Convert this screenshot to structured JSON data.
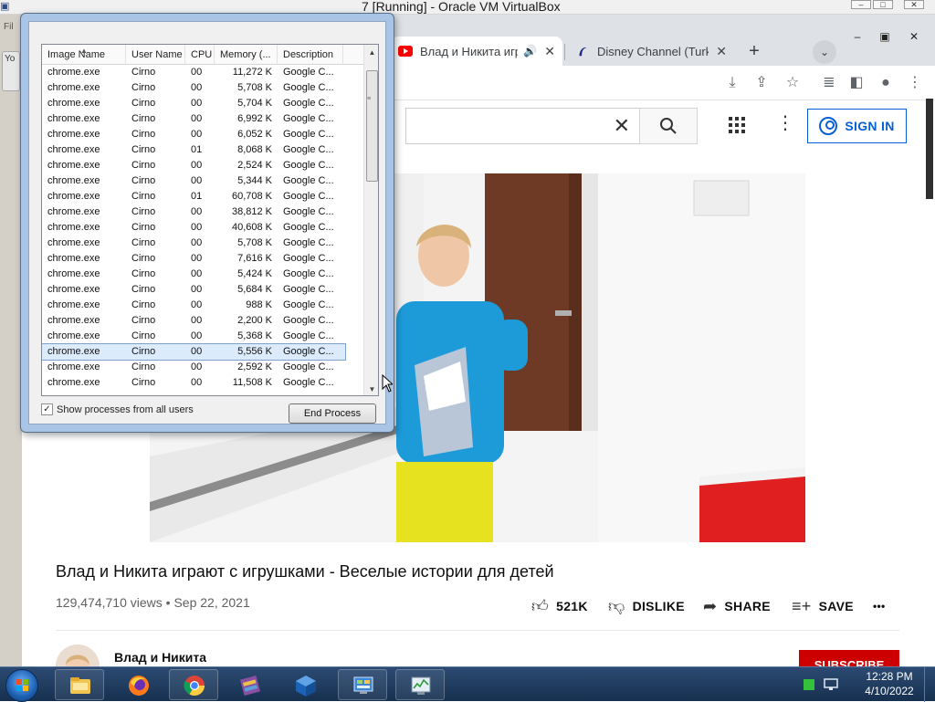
{
  "host": {
    "title": "7 [Running] - Oracle VM VirtualBox",
    "left_stub_text": "Fil",
    "left_tab_text": "Yo"
  },
  "browser": {
    "tabs": [
      {
        "label": "Влад и Никита играют",
        "favicon": "youtube-icon",
        "audio": true,
        "active": true
      },
      {
        "label": "Disney Channel (Turkey)",
        "favicon": "disney-icon",
        "audio": false,
        "active": false
      }
    ],
    "new_tab_symbol": "+",
    "tab_search_symbol": "⌄",
    "close_symbol": "✕"
  },
  "youtube": {
    "search_clear_symbol": "✕",
    "search_icon": "search-icon",
    "sign_in_label": "SIGN IN",
    "video": {
      "title": "Влад и Никита играют с игрушками - Веселые истории для детей",
      "views": "129,474,710 views",
      "separator": "•",
      "date": "Sep 22, 2021",
      "likes": "521K",
      "dislike_label": "DISLIKE",
      "share_label": "SHARE",
      "save_label": "SAVE",
      "more_symbol": "•••"
    },
    "channel": {
      "name": "Влад и Никита",
      "subscribe_label": "SUBSCRIBE"
    }
  },
  "task_manager": {
    "columns": [
      "Image Name",
      "User Name",
      "CPU",
      "Memory (...",
      "Description"
    ],
    "rows": [
      {
        "image": "chrome.exe",
        "user": "Cirno",
        "cpu": "00",
        "memory": "11,272 K",
        "desc": "Google C..."
      },
      {
        "image": "chrome.exe",
        "user": "Cirno",
        "cpu": "00",
        "memory": "5,708 K",
        "desc": "Google C..."
      },
      {
        "image": "chrome.exe",
        "user": "Cirno",
        "cpu": "00",
        "memory": "5,704 K",
        "desc": "Google C..."
      },
      {
        "image": "chrome.exe",
        "user": "Cirno",
        "cpu": "00",
        "memory": "6,992 K",
        "desc": "Google C..."
      },
      {
        "image": "chrome.exe",
        "user": "Cirno",
        "cpu": "00",
        "memory": "6,052 K",
        "desc": "Google C..."
      },
      {
        "image": "chrome.exe",
        "user": "Cirno",
        "cpu": "01",
        "memory": "8,068 K",
        "desc": "Google C..."
      },
      {
        "image": "chrome.exe",
        "user": "Cirno",
        "cpu": "00",
        "memory": "2,524 K",
        "desc": "Google C..."
      },
      {
        "image": "chrome.exe",
        "user": "Cirno",
        "cpu": "00",
        "memory": "5,344 K",
        "desc": "Google C..."
      },
      {
        "image": "chrome.exe",
        "user": "Cirno",
        "cpu": "01",
        "memory": "60,708 K",
        "desc": "Google C..."
      },
      {
        "image": "chrome.exe",
        "user": "Cirno",
        "cpu": "00",
        "memory": "38,812 K",
        "desc": "Google C..."
      },
      {
        "image": "chrome.exe",
        "user": "Cirno",
        "cpu": "00",
        "memory": "40,608 K",
        "desc": "Google C..."
      },
      {
        "image": "chrome.exe",
        "user": "Cirno",
        "cpu": "00",
        "memory": "5,708 K",
        "desc": "Google C..."
      },
      {
        "image": "chrome.exe",
        "user": "Cirno",
        "cpu": "00",
        "memory": "7,616 K",
        "desc": "Google C..."
      },
      {
        "image": "chrome.exe",
        "user": "Cirno",
        "cpu": "00",
        "memory": "5,424 K",
        "desc": "Google C..."
      },
      {
        "image": "chrome.exe",
        "user": "Cirno",
        "cpu": "00",
        "memory": "5,684 K",
        "desc": "Google C..."
      },
      {
        "image": "chrome.exe",
        "user": "Cirno",
        "cpu": "00",
        "memory": "988 K",
        "desc": "Google C..."
      },
      {
        "image": "chrome.exe",
        "user": "Cirno",
        "cpu": "00",
        "memory": "2,200 K",
        "desc": "Google C..."
      },
      {
        "image": "chrome.exe",
        "user": "Cirno",
        "cpu": "00",
        "memory": "5,368 K",
        "desc": "Google C..."
      },
      {
        "image": "chrome.exe",
        "user": "Cirno",
        "cpu": "00",
        "memory": "5,556 K",
        "desc": "Google C...",
        "selected": true
      },
      {
        "image": "chrome.exe",
        "user": "Cirno",
        "cpu": "00",
        "memory": "2,592 K",
        "desc": "Google C..."
      },
      {
        "image": "chrome.exe",
        "user": "Cirno",
        "cpu": "00",
        "memory": "11,508 K",
        "desc": "Google C..."
      }
    ],
    "show_all_label": "Show processes from all users",
    "show_all_checked": true,
    "end_process_label": "End Process"
  },
  "taskbar": {
    "pinned": [
      "explorer-icon",
      "firefox-icon",
      "chrome-icon",
      "winrar-icon",
      "virtualbox-icon",
      "control-panel-icon",
      "task-manager-icon"
    ],
    "time": "12:28 PM",
    "date": "4/10/2022"
  },
  "colors": {
    "youtube_blue": "#065fd4",
    "youtube_red": "#cc0000",
    "taskbar": "#1f3b60"
  }
}
